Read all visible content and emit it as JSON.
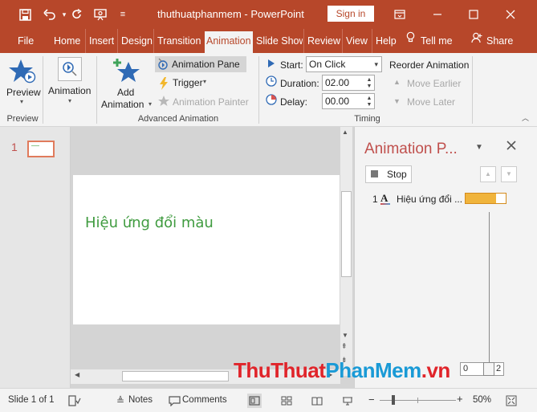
{
  "titlebar": {
    "title": "thuthuatphanmem - PowerPoint",
    "signin": "Sign in",
    "qa_icons": [
      "save-icon",
      "undo-icon",
      "redo-icon",
      "present-icon",
      "customize-icon"
    ],
    "win_icons": [
      "ribbon-options-icon",
      "minimize-icon",
      "maximize-icon",
      "close-icon"
    ]
  },
  "tabs": [
    {
      "label": "File"
    },
    {
      "label": "Home"
    },
    {
      "label": "Insert"
    },
    {
      "label": "Design"
    },
    {
      "label": "Transition"
    },
    {
      "label": "Animation"
    },
    {
      "label": "Slide Show"
    },
    {
      "label": "Review"
    },
    {
      "label": "View"
    },
    {
      "label": "Help"
    },
    {
      "label": "Tell me"
    },
    {
      "label": "Share"
    }
  ],
  "ribbon": {
    "preview": {
      "label": "Preview",
      "group": "Preview"
    },
    "animation_label": "Animation",
    "add_animation": {
      "line1": "Add",
      "line2": "Animation"
    },
    "animation_pane": "Animation Pane",
    "trigger": "Trigger",
    "animation_painter": "Animation Painter",
    "advanced_group": "Advanced Animation",
    "start_label": "Start:",
    "start_value": "On Click",
    "duration_label": "Duration:",
    "duration_value": "02.00",
    "delay_label": "Delay:",
    "delay_value": "00.00",
    "timing_group": "Timing",
    "reorder_title": "Reorder Animation",
    "move_earlier": "Move Earlier",
    "move_later": "Move Later"
  },
  "thumbnails": {
    "number": "1"
  },
  "slide": {
    "text": "Hiệu ứng đổi màu"
  },
  "animpane": {
    "title": "Animation P...",
    "stop": "Stop",
    "item_number": "1",
    "item_label": "Hiệu ứng đổi ...",
    "timeline_start": "0",
    "timeline_end": "2"
  },
  "status": {
    "slide_info": "Slide 1 of 1",
    "notes": "Notes",
    "comments": "Comments",
    "zoom": "50%"
  },
  "watermark": {
    "part1": "ThuThuat",
    "part2": "PhanMem",
    "part3": ".vn"
  },
  "colors": {
    "accent": "#b7472a",
    "slide_text": "#3f9b3f",
    "bar": "#f0b43c"
  }
}
